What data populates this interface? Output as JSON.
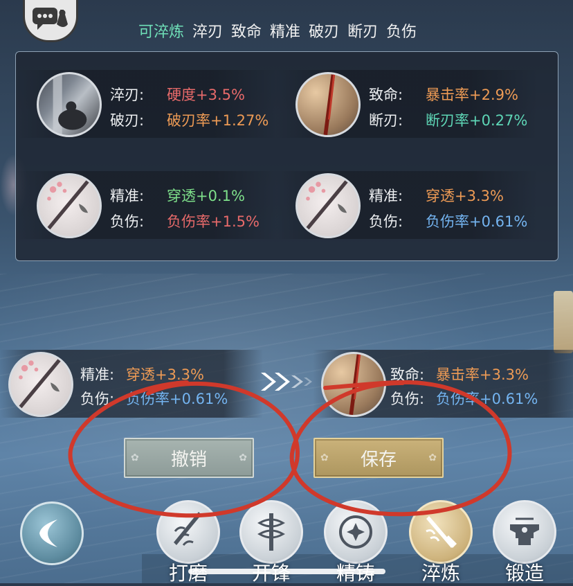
{
  "filter": {
    "items": [
      "可淬炼",
      "淬刃",
      "致命",
      "精准",
      "破刃",
      "断刃",
      "负伤"
    ],
    "active_index": 0
  },
  "panel": {
    "entries": [
      {
        "icon": "dark-sword-gem",
        "lines": [
          {
            "key": "淬刃:",
            "value": "硬度+3.5%",
            "color": "#e86a6a"
          },
          {
            "key": "破刃:",
            "value": "破刃率+1.27%",
            "color": "#ee9b55"
          }
        ]
      },
      {
        "icon": "red-blade-gem",
        "lines": [
          {
            "key": "致命:",
            "value": "暴击率+2.9%",
            "color": "#ee9b55"
          },
          {
            "key": "断刃:",
            "value": "断刃率+0.27%",
            "color": "#5ed6b6"
          }
        ]
      },
      {
        "icon": "blossom-blade-gem",
        "lines": [
          {
            "key": "精准:",
            "value": "穿透+0.1%",
            "color": "#7ee08a"
          },
          {
            "key": "负伤:",
            "value": "负伤率+1.5%",
            "color": "#e86a6a"
          }
        ]
      },
      {
        "icon": "blossom-blade-gem",
        "lines": [
          {
            "key": "精准:",
            "value": "穿透+3.3%",
            "color": "#ee9b55"
          },
          {
            "key": "负伤:",
            "value": "负伤率+0.61%",
            "color": "#74b4f0"
          }
        ]
      }
    ]
  },
  "compare": {
    "current": {
      "icon": "blossom-blade-gem",
      "lines": [
        {
          "key": "精准:",
          "value": "穿透+3.3%",
          "color": "#ee9b55"
        },
        {
          "key": "负伤:",
          "value": "负伤率+0.61%",
          "color": "#74b4f0"
        }
      ]
    },
    "new": {
      "icon": "red-blade-gem",
      "lines": [
        {
          "key": "致命:",
          "value": "暴击率+3.3%",
          "color": "#ee9b55"
        },
        {
          "key": "负伤:",
          "value": "负伤率+0.61%",
          "color": "#74b4f0"
        }
      ]
    }
  },
  "actions": {
    "undo_label": "撤销",
    "save_label": "保存"
  },
  "nav": {
    "back_icon": "back-arrow-icon",
    "items": [
      {
        "label": "打磨",
        "icon": "grind-icon"
      },
      {
        "label": "开锋",
        "icon": "sharpen-icon"
      },
      {
        "label": "精铸",
        "icon": "refine-cast-icon"
      },
      {
        "label": "淬炼",
        "icon": "temper-icon"
      },
      {
        "label": "锻造",
        "icon": "forge-icon"
      }
    ],
    "active_index": 3
  },
  "colors": {
    "accent_teal": "#6fe0b8",
    "annotation_red": "#d0392b"
  }
}
